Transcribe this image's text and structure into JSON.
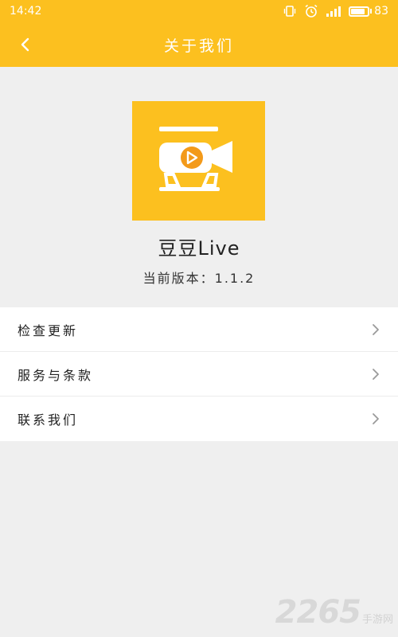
{
  "status_bar": {
    "time": "14:42",
    "battery_level": "83",
    "battery_fraction": 0.83
  },
  "header": {
    "title": "关于我们",
    "back_icon": "chevron-left-icon"
  },
  "app": {
    "logo_icon": "video-camera-play-icon",
    "name": "豆豆Live",
    "version_text": "当前版本：1.1.2"
  },
  "menu": {
    "items": [
      {
        "label": "检查更新",
        "icon": "chevron-right-icon"
      },
      {
        "label": "服务与条款",
        "icon": "chevron-right-icon"
      },
      {
        "label": "联系我们",
        "icon": "chevron-right-icon"
      }
    ]
  },
  "watermark": {
    "number": "2265",
    "suffix": "手游网"
  },
  "colors": {
    "accent": "#fcc01f",
    "background": "#efefef",
    "play_icon": "#f39a1a"
  }
}
